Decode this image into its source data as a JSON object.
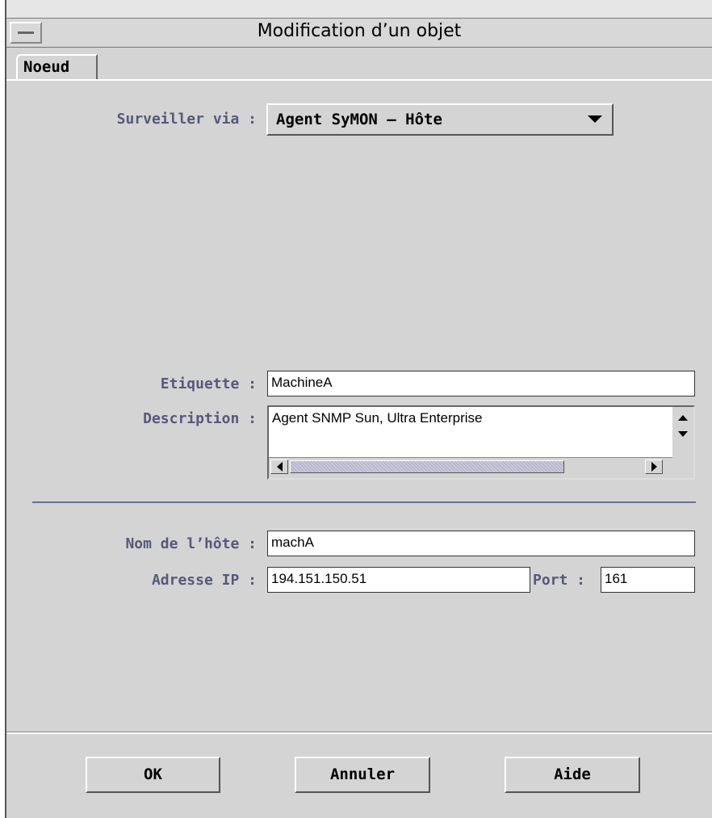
{
  "window": {
    "title": "Modification d’un objet"
  },
  "tabs": [
    {
      "label": "Noeud"
    }
  ],
  "form": {
    "monitor_label": "Surveiller via :",
    "monitor_value": "Agent SyMON – Hôte",
    "label_label": "Etiquette :",
    "label_value": "MachineA",
    "description_label": "Description :",
    "description_value": "Agent SNMP Sun, Ultra Enterprise",
    "hostname_label": "Nom de l’hôte :",
    "hostname_value": "machA",
    "ip_label": "Adresse IP :",
    "ip_value": "194.151.150.51",
    "port_label": "Port :",
    "port_value": "161"
  },
  "buttons": {
    "ok": "OK",
    "cancel": "Annuler",
    "help": "Aide"
  },
  "icons": [
    "window-menu-icon",
    "dropdown-arrow-icon",
    "scroll-up-icon",
    "scroll-down-icon",
    "scroll-left-icon",
    "scroll-right-icon"
  ],
  "colors": {
    "label": "#55597a",
    "separator": "#6a6e96",
    "background": "#d4d4d4"
  }
}
